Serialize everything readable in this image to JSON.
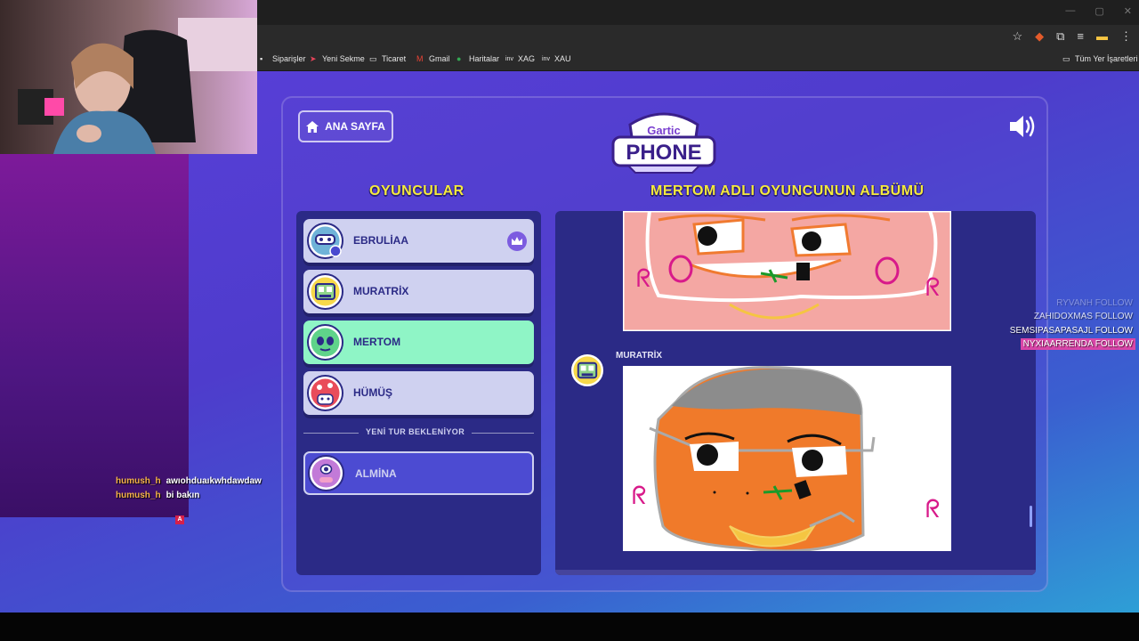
{
  "browser": {
    "window_controls": [
      "—",
      "▢",
      "✕"
    ],
    "bookmarks": [
      {
        "label": "Siparişler",
        "icon": "bookmark-icon"
      },
      {
        "label": "Yeni Sekme",
        "icon": "arrow-icon"
      },
      {
        "label": "Ticaret",
        "icon": "folder-icon"
      },
      {
        "label": "Gmail",
        "icon": "gmail-icon"
      },
      {
        "label": "Haritalar",
        "icon": "maps-icon"
      },
      {
        "label": "XAG",
        "icon": "inv-icon"
      },
      {
        "label": "XAU",
        "icon": "inv-icon"
      }
    ],
    "all_bookmarks": "Tüm Yer İşaretleri"
  },
  "game": {
    "home_button": "ANA SAYFA",
    "logo_top": "Gartic",
    "logo_bottom": "PHONE",
    "players_title": "OYUNCULAR",
    "album_title": "MERTOM ADLI OYUNCUNUN ALBÜMÜ",
    "players": [
      {
        "name": "EBRULİAA",
        "host": true,
        "active": false
      },
      {
        "name": "MURATRİX",
        "host": false,
        "active": false
      },
      {
        "name": "MERTOM",
        "host": false,
        "active": true
      },
      {
        "name": "HÜMÜŞ",
        "host": false,
        "active": false
      }
    ],
    "waiting_label": "YENİ TUR BEKLENİYOR",
    "waiting_players": [
      {
        "name": "ALMİNA"
      }
    ],
    "album_entries": [
      {
        "author": "MURATRİX"
      }
    ]
  },
  "overlay": {
    "chat": [
      {
        "user": "humush_h",
        "message": "awıohduaıkwhdawdaw"
      },
      {
        "user": "humush_h",
        "message": "bi bakın"
      }
    ],
    "chat_badge": "A",
    "follows": [
      {
        "name": "RYVANH",
        "label": "FOLLOW"
      },
      {
        "name": "ZAHIDOXMAS",
        "label": "FOLLOW"
      },
      {
        "name": "SEMSIPASAPASAJL",
        "label": "FOLLOW"
      },
      {
        "name": "NYXIAARRENDA",
        "label": "FOLLOW"
      }
    ]
  },
  "colors": {
    "accent_yellow": "#f5ea3c",
    "active_player": "#8ff5c6",
    "panel": "#2b2a86"
  }
}
